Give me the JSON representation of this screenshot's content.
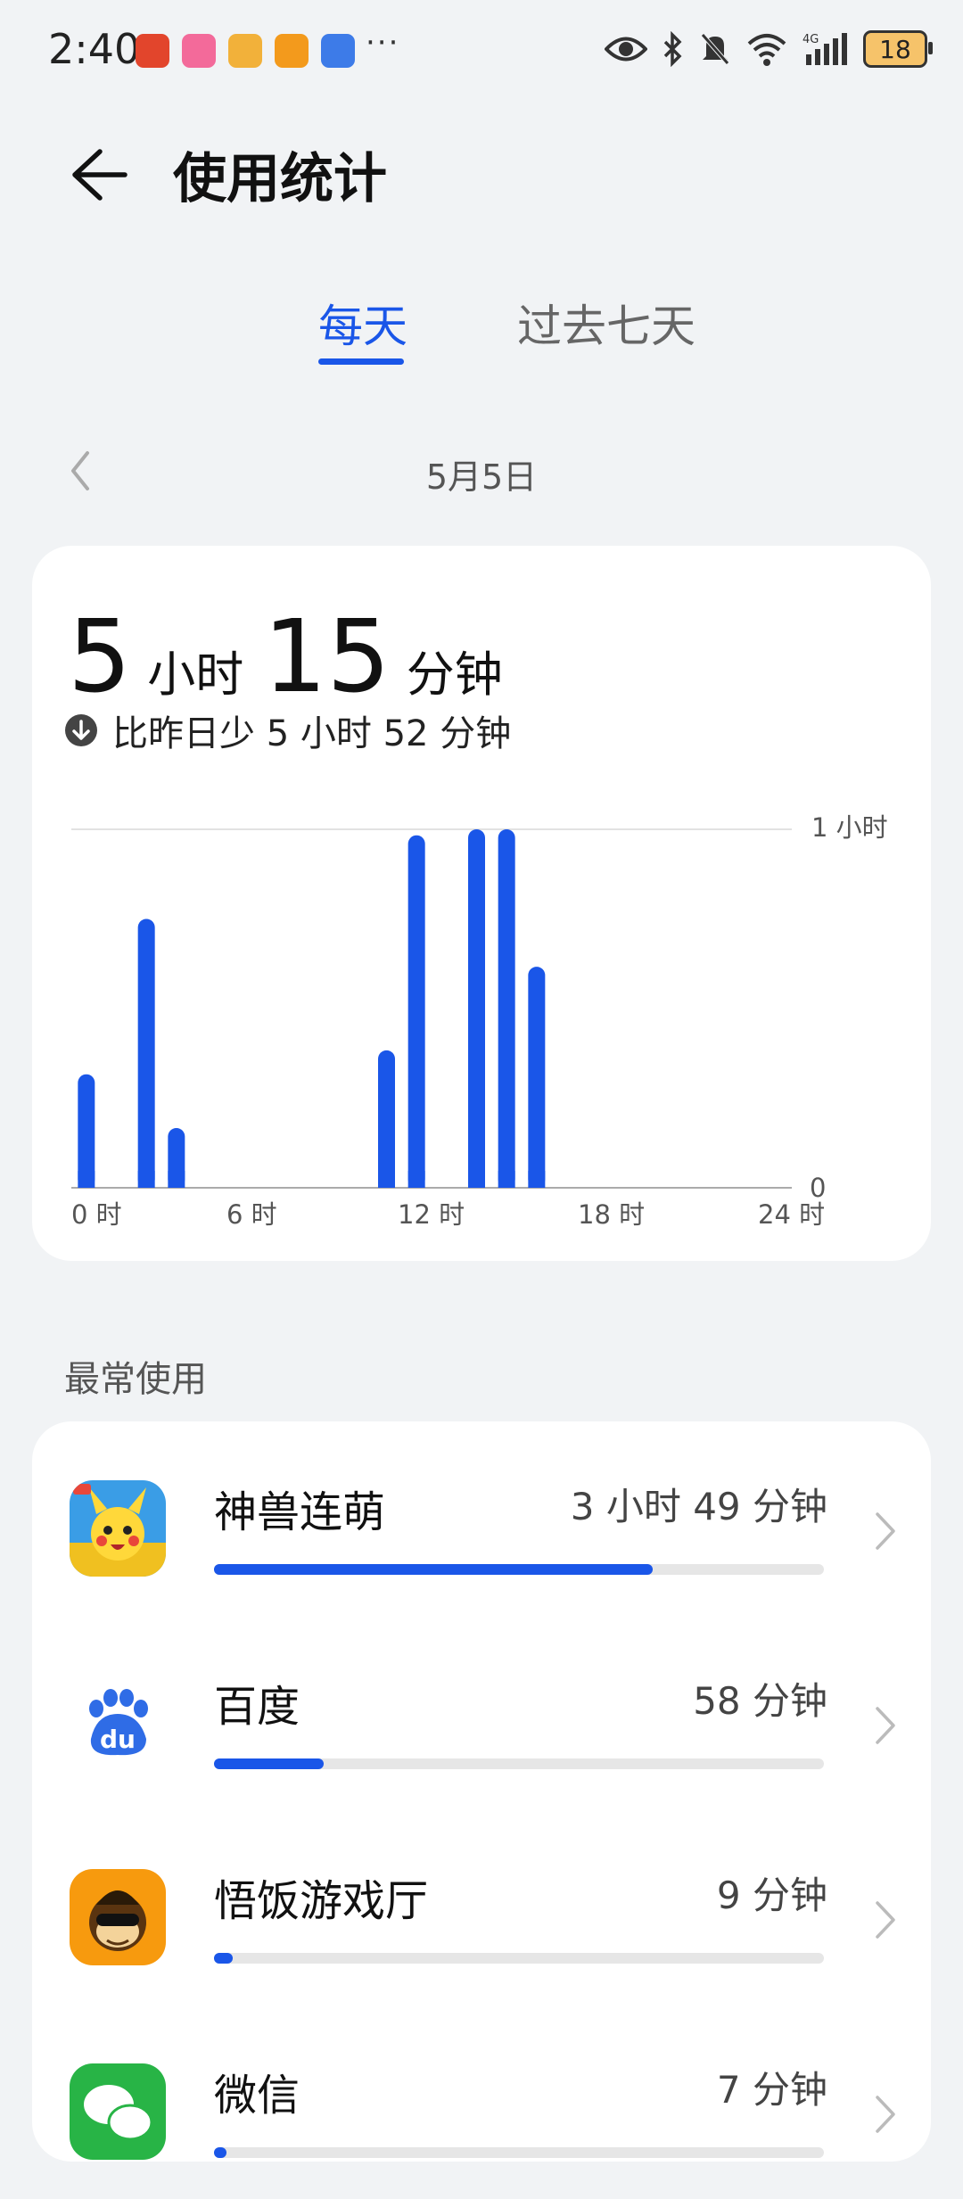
{
  "status_bar": {
    "time": "2:40",
    "more": "···",
    "network": "4G",
    "battery": "18",
    "icons": [
      "eye-icon",
      "bluetooth-icon",
      "mute-icon",
      "wifi-icon",
      "signal-icon",
      "battery-icon"
    ]
  },
  "header": {
    "title": "使用统计"
  },
  "tabs": [
    {
      "label": "每天",
      "active": true
    },
    {
      "label": "过去七天",
      "active": false
    }
  ],
  "date": "5月5日",
  "summary": {
    "hours": "5",
    "hours_unit": "小时",
    "minutes": "15",
    "minutes_unit": "分钟",
    "compare": "比昨日少 5 小时 52 分钟"
  },
  "chart_data": {
    "type": "bar",
    "x_unit": "hour",
    "x": [
      0.5,
      2.5,
      3.5,
      10.5,
      11.5,
      13.5,
      14.5,
      15.5
    ],
    "values": [
      19,
      45,
      10,
      23,
      59,
      60,
      60,
      37
    ],
    "xlim": [
      0,
      24
    ],
    "ylim": [
      0,
      60
    ],
    "x_ticks": [
      "0 时",
      "6 时",
      "12 时",
      "18 时",
      "24 时"
    ],
    "y_ticks": [
      "0",
      "1 小时"
    ],
    "color": "#1a56e8"
  },
  "section_label": "最常使用",
  "apps": [
    {
      "name": "神兽连萌",
      "time": "3 小时 49 分钟",
      "fraction": 0.72,
      "icon": "pikachu-game-icon"
    },
    {
      "name": "百度",
      "time": "58 分钟",
      "fraction": 0.18,
      "icon": "baidu-icon"
    },
    {
      "name": "悟饭游戏厅",
      "time": "9 分钟",
      "fraction": 0.03,
      "icon": "wufan-game-icon"
    },
    {
      "name": "微信",
      "time": "7 分钟",
      "fraction": 0.02,
      "icon": "wechat-icon"
    }
  ]
}
